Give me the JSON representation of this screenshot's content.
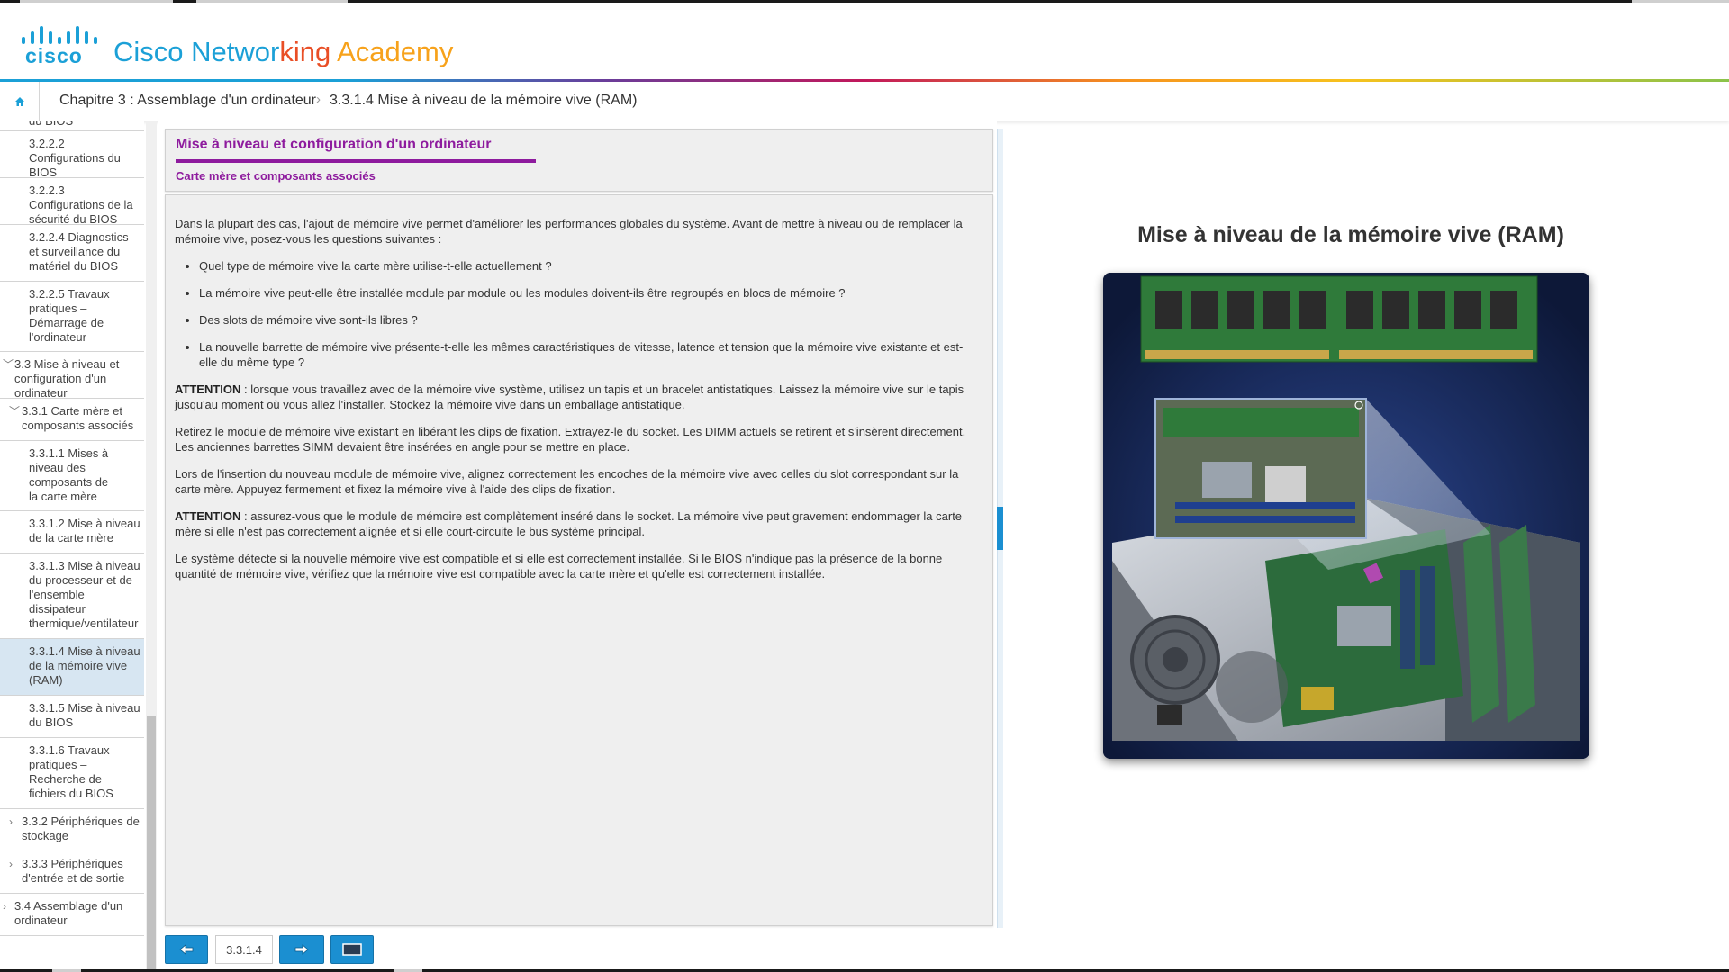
{
  "header": {
    "logo_text": "cisco",
    "brand_word1": "Cisco Networ",
    "brand_word2": "king",
    "brand_word3": " Academy"
  },
  "breadcrumb": {
    "chapter": "Chapitre 3 : Assemblage d'un ordinateur",
    "separator": "›",
    "current": "3.3.1.4 Mise à niveau de la mémoire vive (RAM)"
  },
  "nav": {
    "items": [
      {
        "label": "du BIOS"
      },
      {
        "label": "3.2.2.2 Configurations du BIOS"
      },
      {
        "label": "3.2.2.3 Configurations de la sécurité du BIOS"
      },
      {
        "label": "3.2.2.4 Diagnostics et surveillance du matériel du BIOS"
      },
      {
        "label": "3.2.2.5 Travaux pratiques – Démarrage de l'ordinateur"
      },
      {
        "label": "3.3 Mise à niveau et configuration d'un ordinateur"
      },
      {
        "label": "3.3.1 Carte mère et composants associés"
      },
      {
        "label": "3.3.1.1 Mises à niveau des composants de la carte mère"
      },
      {
        "label": "3.3.1.2 Mise à niveau de la carte mère"
      },
      {
        "label": "3.3.1.3 Mise à niveau du processeur et de l'ensemble dissipateur thermique/ventilateur"
      },
      {
        "label": "3.3.1.4 Mise à niveau de la mémoire vive (RAM)"
      },
      {
        "label": "3.3.1.5 Mise à niveau du BIOS"
      },
      {
        "label": "3.3.1.6 Travaux pratiques – Recherche de fichiers du BIOS"
      },
      {
        "label": "3.3.2 Périphériques de stockage"
      },
      {
        "label": "3.3.3 Périphériques d'entrée et de sortie"
      },
      {
        "label": "3.4 Assemblage d'un ordinateur"
      }
    ]
  },
  "panel": {
    "title": "Mise à niveau et configuration d'un ordinateur",
    "subtitle": "Carte mère et composants associés"
  },
  "content": {
    "intro": "Dans la plupart des cas, l'ajout de mémoire vive permet d'améliorer les performances globales du système. Avant de mettre à niveau ou de remplacer la mémoire vive, posez-vous les questions suivantes :",
    "bullets": [
      "Quel type de mémoire vive la carte mère utilise-t-elle actuellement ?",
      "La mémoire vive peut-elle être installée module par module ou les modules doivent-ils être regroupés en blocs de mémoire ?",
      "Des slots de mémoire vive sont-ils libres ?",
      "La nouvelle barrette de mémoire vive présente-t-elle les mêmes caractéristiques de vitesse, latence et tension que la mémoire vive existante et est-elle du même type ?"
    ],
    "attention_label": "ATTENTION",
    "attention1": " : lorsque vous travaillez avec de la mémoire vive système, utilisez un tapis et un bracelet antistatiques. Laissez la mémoire vive sur le tapis jusqu'au moment où vous allez l'installer. Stockez la mémoire vive dans un emballage antistatique.",
    "para2": "Retirez le module de mémoire vive existant en libérant les clips de fixation. Extrayez-le du socket. Les DIMM actuels se retirent et s'insèrent directement. Les anciennes barrettes SIMM devaient être insérées en angle pour se mettre en place.",
    "para3": "Lors de l'insertion du nouveau module de mémoire vive, alignez correctement les encoches de la mémoire vive avec celles du slot correspondant sur la carte mère. Appuyez fermement et fixez la mémoire vive à l'aide des clips de fixation.",
    "attention2": " : assurez-vous que le module de mémoire est complètement inséré dans le socket. La mémoire vive peut gravement endommager la carte mère si elle n'est pas correctement alignée et si elle court-circuite le bus système principal.",
    "para4": "Le système détecte si la nouvelle mémoire vive est compatible et si elle est correctement installée. Si le BIOS n'indique pas la présence de la bonne quantité de mémoire vive, vérifiez que la mémoire vive est compatible avec la carte mère et qu'elle est correctement installée."
  },
  "pager": {
    "page": "3.3.1.4"
  },
  "media": {
    "title": "Mise à niveau de la mémoire vive (RAM)"
  },
  "colors": {
    "cisco_blue": "#1ba0d7",
    "accent_purple": "#8e1b9e",
    "button_blue": "#1b8fd1",
    "selected_nav": "#d7e6f2"
  }
}
